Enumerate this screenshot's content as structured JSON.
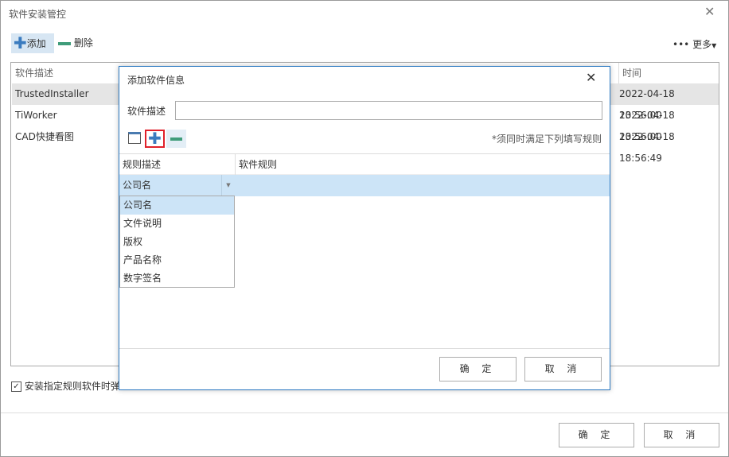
{
  "window": {
    "title": "软件安装管控"
  },
  "toolbar": {
    "add_label": "添加",
    "delete_label": "删除",
    "more_label": "更多"
  },
  "table": {
    "headers": [
      "软件描述",
      "时间"
    ],
    "rows": [
      {
        "desc": "TrustedInstaller",
        "time": "2022-04-18 13:56:00"
      },
      {
        "desc": "TiWorker",
        "time": "2022-04-18 13:56:00"
      },
      {
        "desc": "CAD快捷看图",
        "time": "2022-04-18 18:56:49"
      }
    ]
  },
  "checkbox": {
    "label": "安装指定规则软件时弹",
    "checked": true
  },
  "footer": {
    "ok": "确 定",
    "cancel": "取 消"
  },
  "dialog": {
    "title": "添加软件信息",
    "desc_label": "软件描述",
    "desc_value": "",
    "note": "*须同时满足下列填写规则",
    "grid_headers": [
      "规则描述",
      "软件规则"
    ],
    "selected_value": "公司名",
    "options": [
      "公司名",
      "文件说明",
      "版权",
      "产品名称",
      "数字签名"
    ],
    "ok": "确 定",
    "cancel": "取 消"
  },
  "colors": {
    "accent": "#2b6cb0",
    "plus": "#3a7bbf",
    "minus": "#3f9c7a",
    "highlight": "#cce4f7"
  }
}
